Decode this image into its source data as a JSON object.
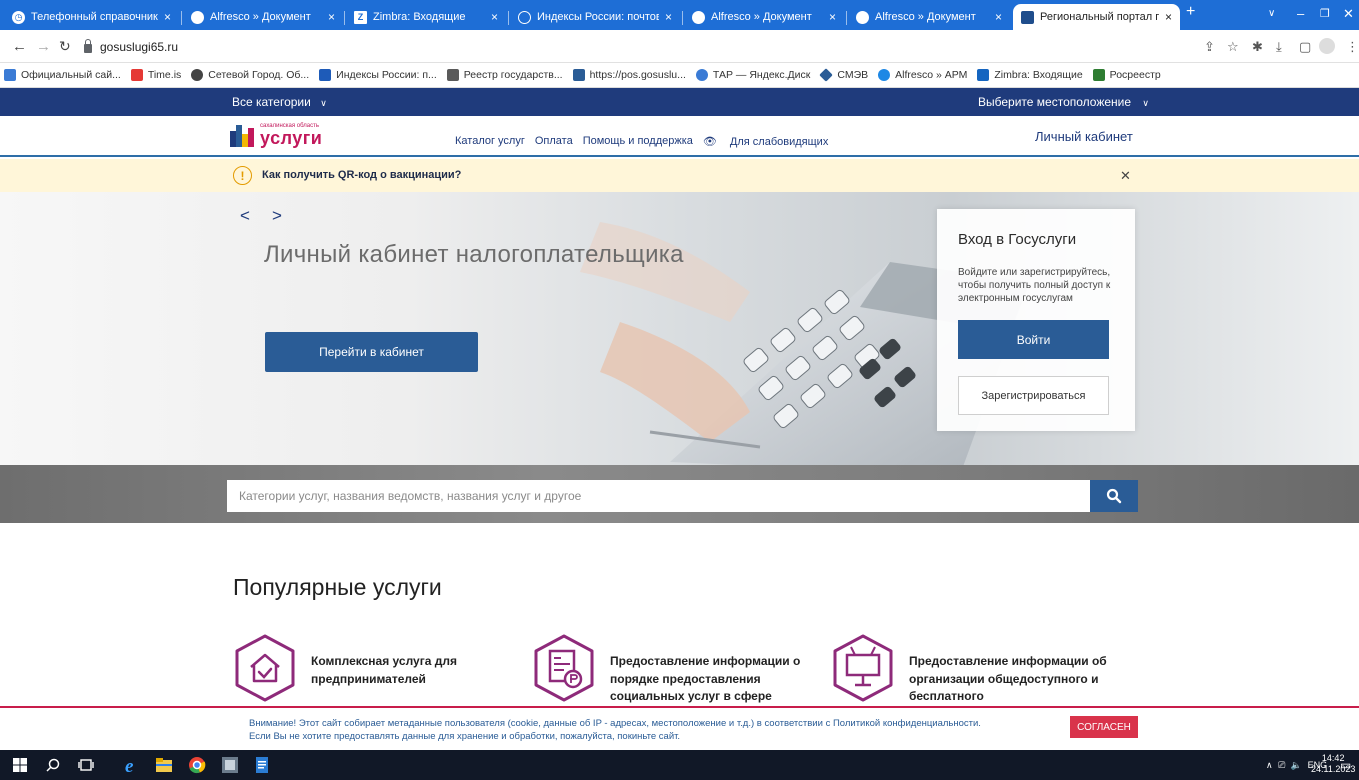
{
  "browser": {
    "tabs": [
      {
        "title": "Телефонный справочник",
        "active": false
      },
      {
        "title": "Alfresco » Документ",
        "active": false
      },
      {
        "title": "Zimbra: Входящие",
        "active": false
      },
      {
        "title": "Индексы России: почтовые ин",
        "active": false
      },
      {
        "title": "Alfresco » Документ",
        "active": false
      },
      {
        "title": "Alfresco » Документ",
        "active": false
      },
      {
        "title": "Региональный портал государ",
        "active": true
      }
    ],
    "url": "gosuslugi65.ru",
    "bookmarks": [
      {
        "label": "Официальный сай...",
        "color": "#3a7bd5"
      },
      {
        "label": "Time.is",
        "color": "#e53935"
      },
      {
        "label": "Сетевой Город. Об...",
        "color": "#444444"
      },
      {
        "label": "Индексы России: п...",
        "color": "#1e5bb8"
      },
      {
        "label": "Реестр государств...",
        "color": "#5a5a5a"
      },
      {
        "label": "https://pos.gosuslu...",
        "color": "#2a5c96"
      },
      {
        "label": "ТАР — Яндекс.Диск",
        "color": "#3a7bd5"
      },
      {
        "label": "СМЭВ",
        "color": "#2a5c96"
      },
      {
        "label": "Alfresco » АРМ",
        "color": "#1e88e5"
      },
      {
        "label": "Zimbra: Входящие",
        "color": "#1565c0"
      },
      {
        "label": "Росреестр",
        "color": "#2e7d32"
      }
    ]
  },
  "site": {
    "topnav": {
      "categories": "Все категории",
      "location": "Выберите местоположение"
    },
    "logo": {
      "region": "сахалинская область",
      "name": "услуги"
    },
    "mainnav": [
      "Каталог услуг",
      "Оплата",
      "Помощь и поддержка",
      "Для слабовидящих"
    ],
    "cabinet": "Личный кабинет",
    "notice": "Как получить QR-код о вакцинации?",
    "hero": {
      "title": "Личный кабинет налогоплательщика",
      "cta": "Перейти в кабинет"
    },
    "login": {
      "heading": "Вход в Госуслуги",
      "text": "Войдите или зарегистрируйтесь, чтобы получить полный доступ к электронным госуслугам",
      "login_btn": "Войти",
      "register_btn": "Зарегистрироваться"
    },
    "search": {
      "placeholder": "Категории услуг, названия ведомств, названия услуг и другое"
    },
    "popular": {
      "title": "Популярные услуги",
      "items": [
        {
          "label": "Комплексная услуга для предпринимателей",
          "icon": "house-check-icon"
        },
        {
          "label": "Предоставление информации о порядке предоставления социальных услуг в сфере",
          "icon": "document-ruble-icon"
        },
        {
          "label": "Предоставление информации об организации общедоступного и бесплатного",
          "icon": "billboard-icon"
        }
      ]
    },
    "cookie": {
      "line1": "Внимание! Этот сайт собирает метаданные пользователя (cookie, данные об IP - адресах, местоположение и т.д.) в соответствии с Политикой конфиденциальности.",
      "line2": "Если Вы не хотите предоставлять данные для хранение и обработки, пожалуйста, покиньте сайт.",
      "accept": "СОГЛАСЕН"
    }
  },
  "taskbar": {
    "lang": "ENG",
    "time": "14:42",
    "date": "24.11.2023"
  },
  "colors": {
    "brand_dark": "#1f3b7c",
    "brand_button": "#2a5c96",
    "accent_magenta": "#8e2a7a",
    "logo_red": "#c2185b",
    "notice_bg": "#fff6d9",
    "cookie_accent": "#d9334b"
  }
}
